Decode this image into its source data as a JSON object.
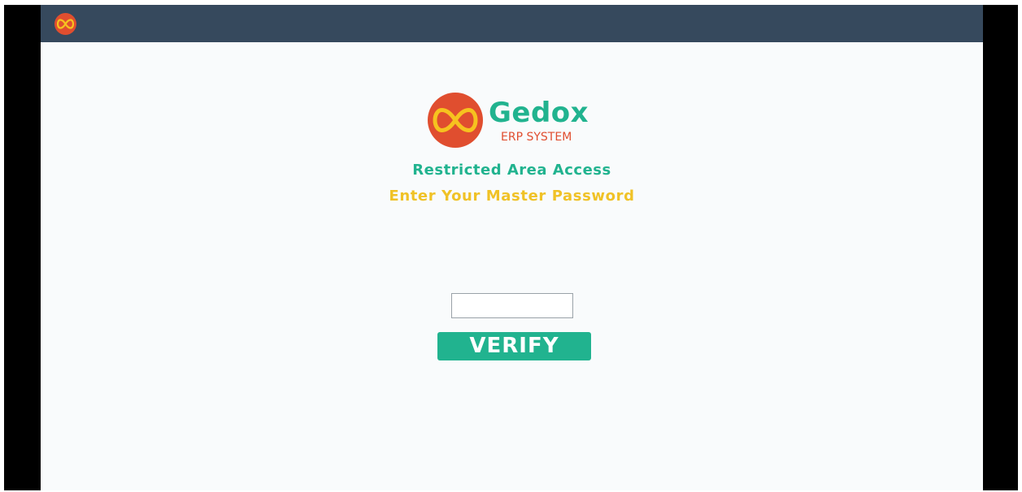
{
  "brand": {
    "name": "Gedox",
    "subtitle": "ERP SYSTEM",
    "logo_icon": "infinity-icon",
    "colors": {
      "logo_bg": "#e04e2f",
      "logo_symbol": "#f6c21f",
      "accent": "#21b38f",
      "topbar": "#36495d"
    }
  },
  "login": {
    "heading": "Restricted Area Access",
    "prompt": "Enter Your Master Password",
    "password_value": "",
    "password_placeholder": "",
    "verify_label": "VERIFY",
    "colors": {
      "heading": "#21b38f",
      "prompt": "#f0c226"
    }
  }
}
